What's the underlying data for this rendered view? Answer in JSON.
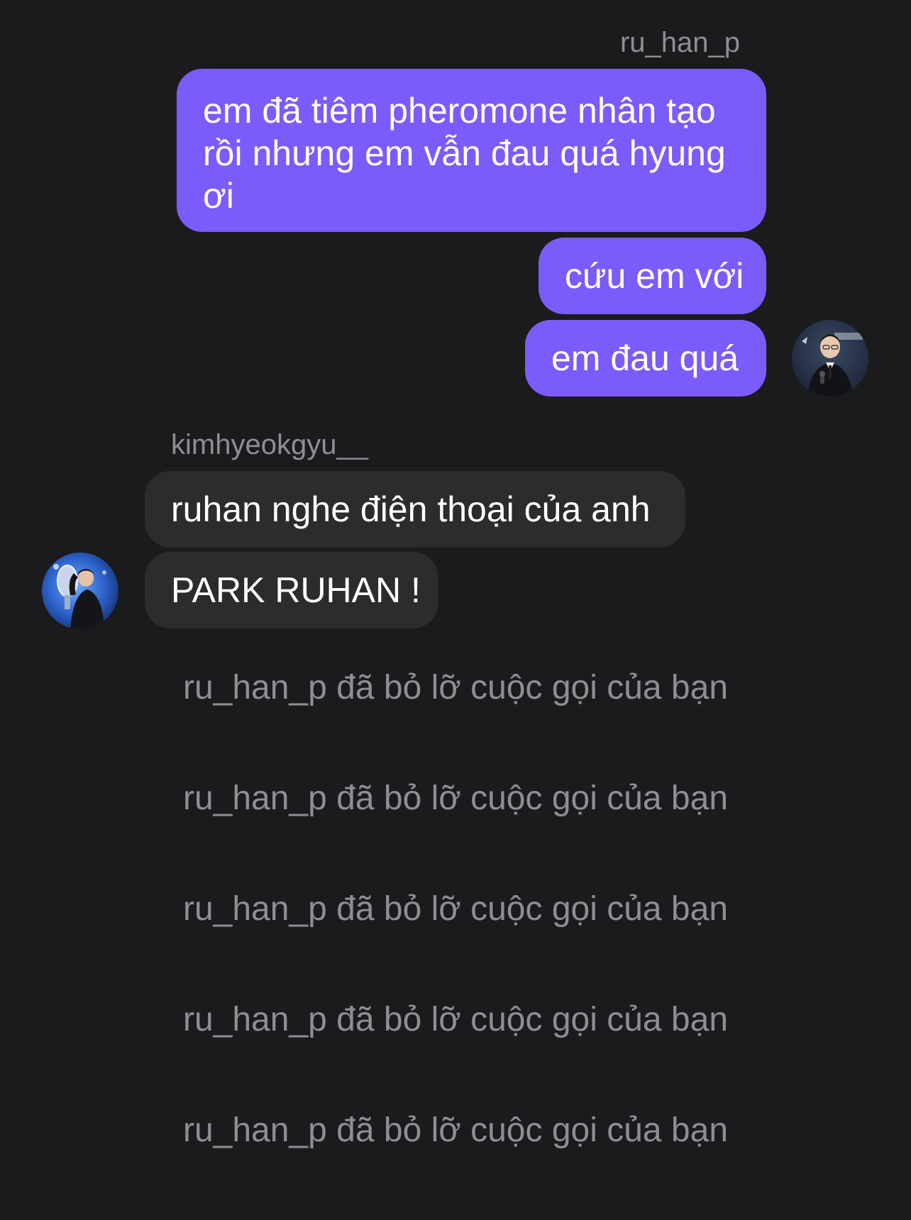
{
  "thread": {
    "outgoing_sender": "ru_han_p",
    "outgoing_messages": [
      {
        "lines": [
          "em đã tiêm pheromone nhân tạo",
          "rồi nhưng em vẫn đau quá hyung",
          "ơi"
        ]
      },
      {
        "text": "cứu em với"
      },
      {
        "text": "em đau quá"
      }
    ],
    "incoming_sender": "kimhyeokgyu__",
    "incoming_messages": [
      {
        "text": "ruhan nghe điện thoại của anh"
      },
      {
        "text": "PARK RUHAN !"
      }
    ],
    "missed_calls": [
      "ru_han_p đã bỏ lỡ cuộc gọi của bạn",
      "ru_han_p đã bỏ lỡ cuộc gọi của bạn",
      "ru_han_p đã bỏ lỡ cuộc gọi của bạn",
      "ru_han_p đã bỏ lỡ cuộc gọi của bạn",
      "ru_han_p đã bỏ lỡ cuộc gọi của bạn"
    ]
  },
  "colors": {
    "background": "#1b1b1d",
    "outgoing_bubble": "#7b5cfa",
    "incoming_bubble": "#2c2c2e",
    "secondary_text": "#8e8e93"
  },
  "icons": {
    "outgoing_avatar": "user-avatar-photo",
    "incoming_avatar": "user-avatar-photo"
  }
}
